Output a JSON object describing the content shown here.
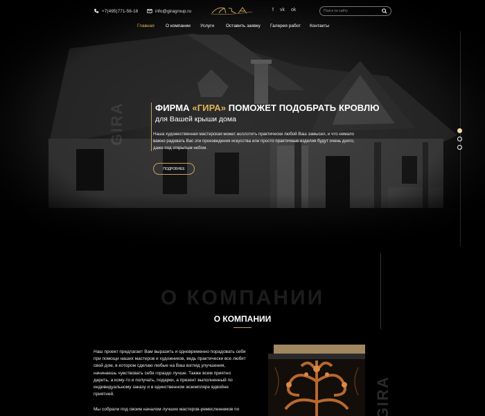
{
  "header": {
    "phone": "+7(495)771-56-18",
    "email": "info@giragroup.ru",
    "logo_text": "GIRA",
    "socials": [
      "f",
      "vk",
      "ok"
    ],
    "search_placeholder": "Поиск по сайту"
  },
  "nav": {
    "items": [
      {
        "label": "Главная",
        "active": true
      },
      {
        "label": "О компании",
        "active": false
      },
      {
        "label": "Услуги",
        "active": false
      },
      {
        "label": "Оставить заявку",
        "active": false
      },
      {
        "label": "Галерея работ",
        "active": false
      },
      {
        "label": "Контакты",
        "active": false
      }
    ]
  },
  "hero": {
    "title_prefix": "ФИРМА ",
    "title_brand": "«ГИРА»",
    "title_suffix": " ПОМОЖЕТ ПОДОБРАТЬ КРОВЛЮ",
    "subtitle": "для Вашей крыши дома",
    "text": "Наша художественная мастерская может воплотить практически любой Ваш замысел, и что немало важно радовать Вас эти произведения искусства или просто практичные изделия будут очень долго, даже под открытым небом.",
    "button_label": "ПОДРОБНЕЕ",
    "vertical_brand": "GIRA",
    "slides": [
      true,
      false,
      false
    ]
  },
  "about": {
    "watermark": "О КОМПАНИИ",
    "title": "О КОМПАНИИ",
    "vertical_brand": "GIRA",
    "paragraph1": "Наш проект предлагает Вам выразить и одновременно порадовать себя при помощи наших мастеров и художников, ведь практически все любят свой дом, в котором сделаю любые на Ваш взгляд улучшения, начинаешь чувствовать себя гораздо лучше. Также всем приятно дарить, а кому-то и получать, подарки, а презент выполненный по индивидуальному заказу и в единственном экземпляре вдвойне приятней.",
    "paragraph2": "Мы собрали под своим началом лучших мастеров-ремесленников по"
  },
  "colors": {
    "accent": "#e3b35a",
    "background": "#000000"
  }
}
